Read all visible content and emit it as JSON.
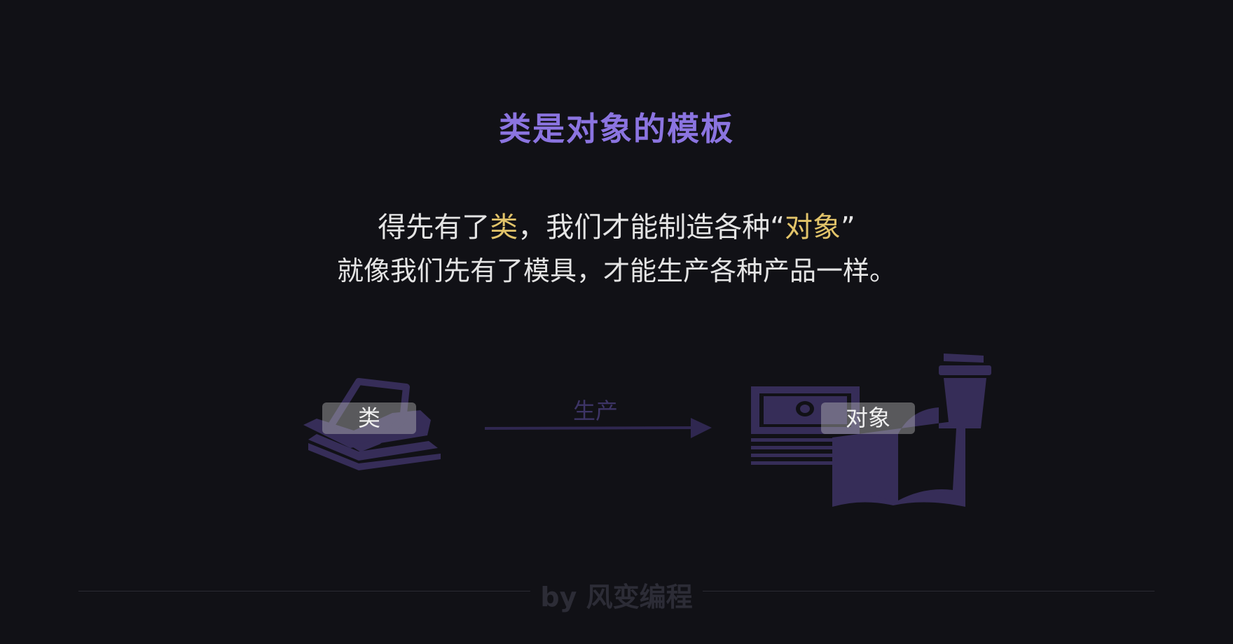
{
  "title": "类是对象的模板",
  "line1": {
    "before": "得先有了",
    "hl1": "类",
    "middle": "，我们才能制造各种“",
    "hl2": "对象",
    "after": "”"
  },
  "line2": "就像我们先有了模具，才能生产各种产品一样。",
  "diagram": {
    "class_label": "类",
    "arrow_label": "生产",
    "object_label": "对象",
    "icons": [
      "papers-stack-icon",
      "arrow-right-icon",
      "banknote-icon",
      "open-book-icon",
      "coffee-cup-icon"
    ]
  },
  "footer": "by 风变编程",
  "colors": {
    "background": "#111116",
    "title": "#8b74e0",
    "highlight": "#e2c46a",
    "icon": "#362d58"
  }
}
